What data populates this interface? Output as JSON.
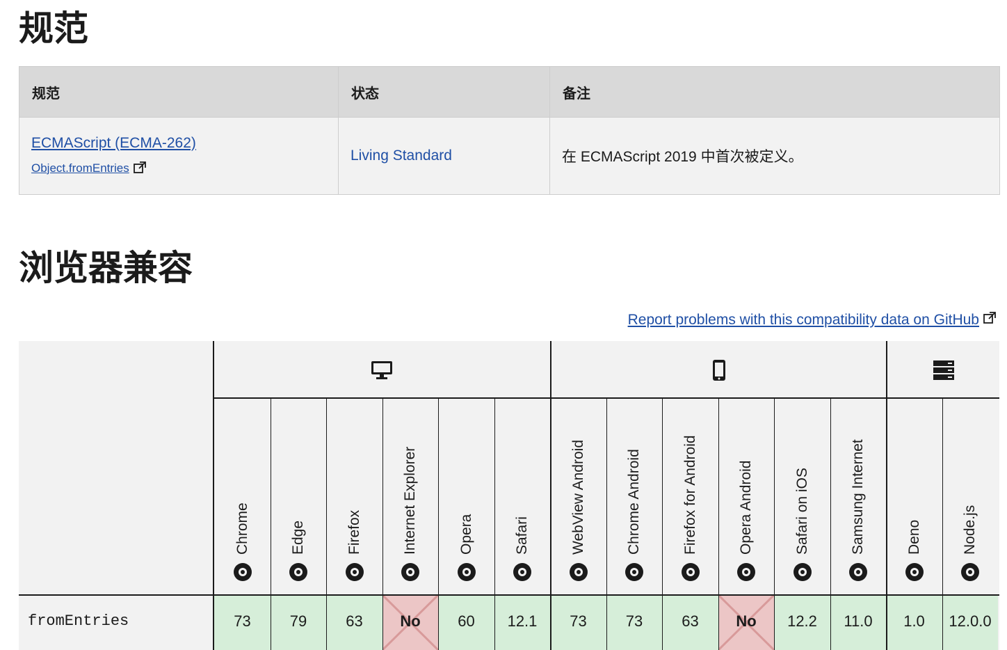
{
  "spec_section": {
    "heading": "规范",
    "columns": [
      "规范",
      "状态",
      "备注"
    ],
    "row": {
      "spec_link": "ECMAScript (ECMA-262)",
      "spec_sub_link": "Object.fromEntries",
      "status": "Living Standard",
      "note": "在 ECMAScript 2019 中首次被定义。"
    }
  },
  "compat_section": {
    "heading": "浏览器兼容",
    "report_link": "Report problems with this compatibility data on GitHub",
    "groups": [
      {
        "name": "desktop",
        "icon": "desktop-icon"
      },
      {
        "name": "mobile",
        "icon": "mobile-icon"
      },
      {
        "name": "server",
        "icon": "server-icon"
      }
    ],
    "browsers": [
      {
        "name": "Chrome",
        "icon": "chrome-icon"
      },
      {
        "name": "Edge",
        "icon": "edge-icon"
      },
      {
        "name": "Firefox",
        "icon": "firefox-icon"
      },
      {
        "name": "Internet Explorer",
        "icon": "ie-icon"
      },
      {
        "name": "Opera",
        "icon": "opera-icon"
      },
      {
        "name": "Safari",
        "icon": "safari-icon"
      },
      {
        "name": "WebView Android",
        "icon": "android-icon"
      },
      {
        "name": "Chrome Android",
        "icon": "chrome-icon"
      },
      {
        "name": "Firefox for Android",
        "icon": "firefox-icon"
      },
      {
        "name": "Opera Android",
        "icon": "opera-icon"
      },
      {
        "name": "Safari on iOS",
        "icon": "safari-icon"
      },
      {
        "name": "Samsung Internet",
        "icon": "samsung-icon"
      },
      {
        "name": "Deno",
        "icon": "deno-icon"
      },
      {
        "name": "Node.js",
        "icon": "nodejs-icon"
      }
    ],
    "feature": "fromEntries",
    "support": [
      {
        "value": "73",
        "supported": true
      },
      {
        "value": "79",
        "supported": true
      },
      {
        "value": "63",
        "supported": true
      },
      {
        "value": "No",
        "supported": false
      },
      {
        "value": "60",
        "supported": true
      },
      {
        "value": "12.1",
        "supported": true
      },
      {
        "value": "73",
        "supported": true
      },
      {
        "value": "73",
        "supported": true
      },
      {
        "value": "63",
        "supported": true
      },
      {
        "value": "No",
        "supported": false
      },
      {
        "value": "12.2",
        "supported": true
      },
      {
        "value": "11.0",
        "supported": true
      },
      {
        "value": "1.0",
        "supported": true
      },
      {
        "value": "12.0.0",
        "supported": true
      }
    ],
    "colors": {
      "yes": "#d6eed9",
      "no": "#ecc6c6",
      "link": "#1f4fa5"
    }
  }
}
